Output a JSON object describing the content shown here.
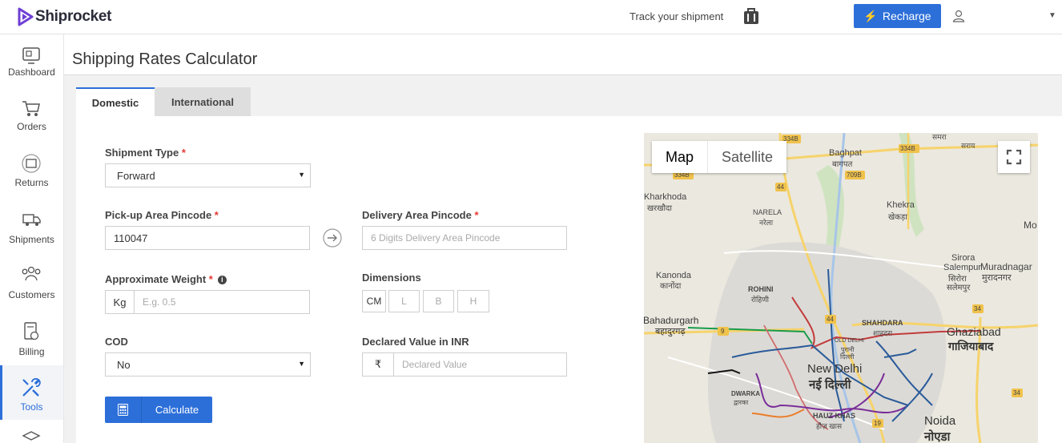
{
  "brand": {
    "name": "Shiprocket",
    "accent": "#2c6fd9"
  },
  "header": {
    "track_label": "Track your shipment",
    "recharge_label": "Recharge"
  },
  "sidebar": {
    "items": [
      {
        "label": "Dashboard",
        "icon": "dashboard-icon"
      },
      {
        "label": "Orders",
        "icon": "cart-icon"
      },
      {
        "label": "Returns",
        "icon": "returns-icon"
      },
      {
        "label": "Shipments",
        "icon": "truck-icon"
      },
      {
        "label": "Customers",
        "icon": "customers-icon"
      },
      {
        "label": "Billing",
        "icon": "billing-icon"
      },
      {
        "label": "Tools",
        "icon": "tools-icon",
        "active": true
      }
    ]
  },
  "page": {
    "title": "Shipping Rates Calculator"
  },
  "tabs": [
    {
      "label": "Domestic",
      "active": true
    },
    {
      "label": "International",
      "active": false
    }
  ],
  "form": {
    "shipment_type": {
      "label": "Shipment Type",
      "required": "*",
      "value": "Forward"
    },
    "pickup": {
      "label": "Pick-up Area Pincode",
      "required": "*",
      "value": "110047"
    },
    "delivery": {
      "label": "Delivery Area Pincode",
      "required": "*",
      "placeholder": "6 Digits Delivery Area Pincode"
    },
    "weight": {
      "label": "Approximate Weight",
      "required": "*",
      "unit": "Kg",
      "placeholder": "E.g. 0.5"
    },
    "dimensions": {
      "label": "Dimensions",
      "unit": "CM",
      "l": "L",
      "b": "B",
      "h": "H"
    },
    "cod": {
      "label": "COD",
      "value": "No"
    },
    "declared": {
      "label": "Declared Value in INR",
      "currency": "₹",
      "placeholder": "Declared Value"
    },
    "calculate_label": "Calculate"
  },
  "map": {
    "toggle_map": "Map",
    "toggle_satellite": "Satellite",
    "labels": {
      "baghpat": "Baghpat",
      "baghpat_hi": "बागपत",
      "kharkhoda": "Kharkhoda",
      "kharkhoda_hi": "खरखौदा",
      "narela": "NARELA",
      "narela_hi": "नरेला",
      "khekra": "Khekra",
      "khekra_hi": "खेकड़ा",
      "kanonda": "Kanonda",
      "kanonda_hi": "कानोंदा",
      "rohini": "ROHINI",
      "rohini_hi": "रोहिणी",
      "sirora": "Sirora",
      "salempur": "Salempur",
      "sirora_hi": "सिरोरा",
      "salempur_hi": "सलेमपुर",
      "muradnagar": "Muradnagar",
      "muradnagar_hi": "मुरादनगर",
      "mo": "Mo",
      "bahadurgarh": "Bahadurgarh",
      "bahadurgarh_hi": "बहादुरगढ़",
      "shahdara": "SHAHDARA",
      "shahdara_hi": "शाहदरा",
      "ghaziabad": "Ghaziabad",
      "ghaziabad_hi": "गाजियाबाद",
      "old_delhi": "OLD DELHI",
      "old_delhi_hi1": "पुरानी",
      "old_delhi_hi2": "दिल्ली",
      "new_delhi": "New Delhi",
      "new_delhi_hi": "नई दिल्ली",
      "dwarka": "DWARKA",
      "dwarka_hi": "द्वारका",
      "hauz_khas": "HAUZ KHAS",
      "hauz_khas_hi": "हौज़ खास",
      "noida": "Noida",
      "noida_hi": "नोएडा",
      "top_hi": "समरा",
      "top_right_hi": "सराय",
      "r334b_1": "334B",
      "r334b_2": "334B",
      "r334b_3": "334B",
      "r709b": "709B",
      "r44a": "44",
      "r44b": "44",
      "r9": "9",
      "r34a": "34",
      "r34b": "34",
      "r19": "19"
    }
  }
}
